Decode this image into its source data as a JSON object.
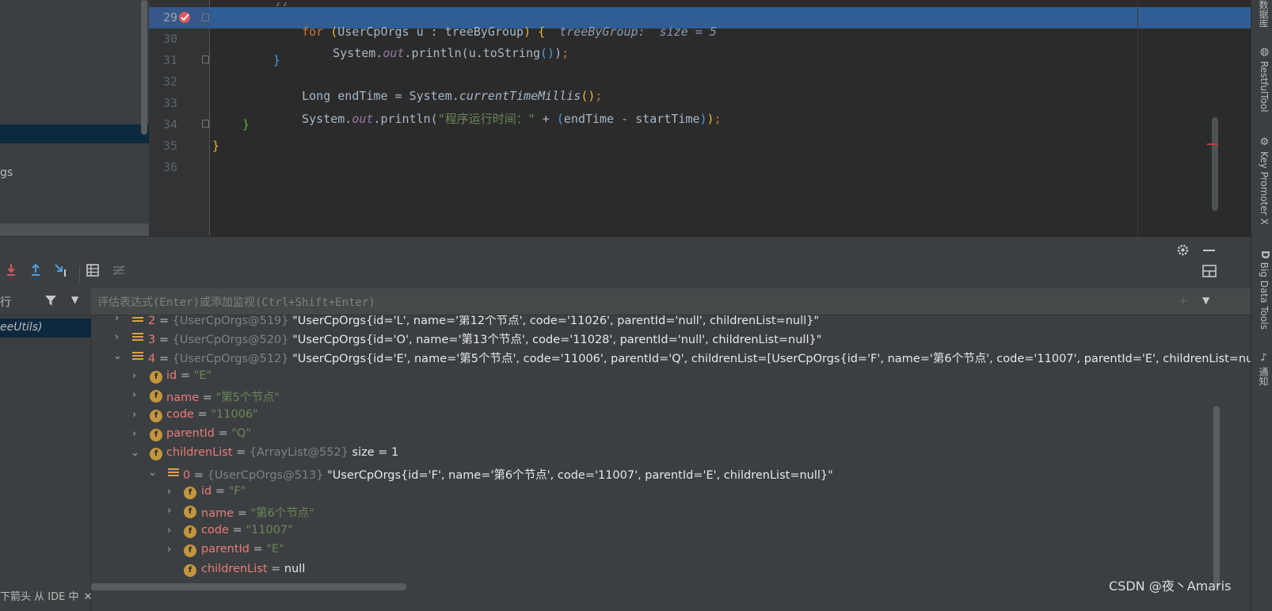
{
  "left_panel": {
    "partial_label": "gs"
  },
  "editor": {
    "lines": [
      {
        "num": "29"
      },
      {
        "num": "30"
      },
      {
        "num": "31"
      },
      {
        "num": "32"
      },
      {
        "num": "33"
      },
      {
        "num": "34"
      },
      {
        "num": "35"
      },
      {
        "num": "36"
      }
    ],
    "line29": {
      "kw_for": "for",
      "open": " (",
      "type": "UserCpOrgs u : treeByGroup",
      "close": ") ",
      "brace": "{",
      "hint": "  treeByGroup:  size = 5"
    },
    "line30": {
      "a": "System.",
      "out": "out",
      "b": ".println(u.toString",
      "paren": "()",
      "c": ")",
      "semi": ";"
    },
    "line31": {
      "brace": "}"
    },
    "line32": {
      "a": "Long endTime = System.",
      "method": "currentTimeMillis",
      "paren": "()",
      "semi": ";"
    },
    "line33": {
      "a": "System.",
      "out": "out",
      "b": ".println(",
      "str": "\"程序运行时间：\"",
      "c": " + ",
      "p1": "(",
      "d": "endTime - startTime",
      "p2": ")",
      "e": ")",
      "semi": ";"
    },
    "line34": {
      "brace": "}"
    },
    "line35": {
      "brace": "}"
    }
  },
  "right_stripe": {
    "tools": [
      {
        "label": "数据库",
        "icon": "database-icon"
      },
      {
        "label": "RestfulTool",
        "icon": "globe-icon"
      },
      {
        "label": "Key Promoter X",
        "icon": "key-icon"
      },
      {
        "label": "Big Data Tools",
        "icon": "d-icon"
      },
      {
        "label": "通知",
        "icon": "bell-icon"
      }
    ]
  },
  "debug": {
    "frames_header_label": "行",
    "frame_selected": "eeUtils)",
    "frames_footer": "下箭头 从 IDE 中",
    "eval_placeholder": "评估表达式(Enter)或添加监视(Ctrl+Shift+Enter)",
    "variables": [
      {
        "index": "2",
        "ref": "{UserCpOrgs@519}",
        "value": "\"UserCpOrgs{id='L', name='第12个节点', code='11026', parentId='null', childrenList=null}\""
      },
      {
        "index": "3",
        "ref": "{UserCpOrgs@520}",
        "value": "\"UserCpOrgs{id='O', name='第13个节点', code='11028', parentId='null', childrenList=null}\""
      },
      {
        "index": "4",
        "ref": "{UserCpOrgs@512}",
        "value": "\"UserCpOrgs{id='E', name='第5个节点', code='11006', parentId='Q', childrenList=[UserCpOrgs{id='F', name='第6个节点', code='11007', parentId='E', childrenList=null}]}\""
      }
    ],
    "fields_4": [
      {
        "name": "id",
        "value": "\"E\""
      },
      {
        "name": "name",
        "value": "\"第5个节点\""
      },
      {
        "name": "code",
        "value": "\"11006\""
      },
      {
        "name": "parentId",
        "value": "\"Q\""
      }
    ],
    "children_list": {
      "name": "childrenList",
      "ref": "{ArrayList@552}",
      "size": "size = 1"
    },
    "child_0": {
      "index": "0",
      "ref": "{UserCpOrgs@513}",
      "value": "\"UserCpOrgs{id='F', name='第6个节点', code='11007', parentId='E', childrenList=null}\""
    },
    "fields_0": [
      {
        "name": "id",
        "value": "\"F\""
      },
      {
        "name": "name",
        "value": "\"第6个节点\""
      },
      {
        "name": "code",
        "value": "\"11007\""
      },
      {
        "name": "parentId",
        "value": "\"E\""
      }
    ],
    "child_children": {
      "name": "childrenList",
      "value": "null"
    }
  },
  "watermark": "CSDN @夜丶Amaris",
  "colors": {
    "highlight": "#2e5e95",
    "keyword": "#cc7832",
    "field": "#eb7a7a",
    "string": "#6a8759"
  }
}
